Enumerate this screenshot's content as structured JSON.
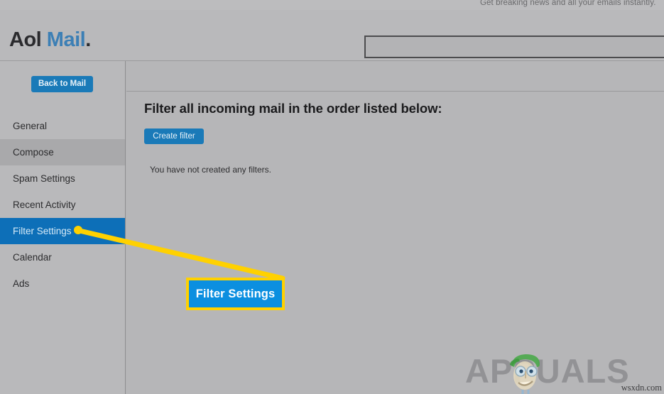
{
  "promo": {
    "text": "Get breaking news and all your emails instantly."
  },
  "header": {
    "logo_aol": "Aol",
    "logo_mail": "Mail",
    "logo_dot": ".",
    "search_value": "",
    "search_placeholder": ""
  },
  "sidebar": {
    "back_to_mail_label": "Back to Mail",
    "items": [
      {
        "label": "General",
        "state": "normal"
      },
      {
        "label": "Compose",
        "state": "hovered"
      },
      {
        "label": "Spam Settings",
        "state": "normal"
      },
      {
        "label": "Recent Activity",
        "state": "normal"
      },
      {
        "label": "Filter Settings",
        "state": "active"
      },
      {
        "label": "Calendar",
        "state": "normal"
      },
      {
        "label": "Ads",
        "state": "normal"
      }
    ]
  },
  "main": {
    "heading": "Filter all incoming mail in the order listed below:",
    "create_filter_label": "Create filter",
    "empty_message": "You have not created any filters."
  },
  "annotation": {
    "callout_label": "Filter Settings",
    "highlight_color": "#ffd100",
    "callout_fill": "#0b8fe0"
  },
  "watermark": {
    "brand": "APPUALS",
    "url": "wsxdn.com"
  },
  "colors": {
    "page_bg": "#b4b4b6",
    "accent_blue": "#1a7ab8",
    "active_row_blue": "#0d6fb8",
    "logo_blue": "#3c7fb5"
  }
}
